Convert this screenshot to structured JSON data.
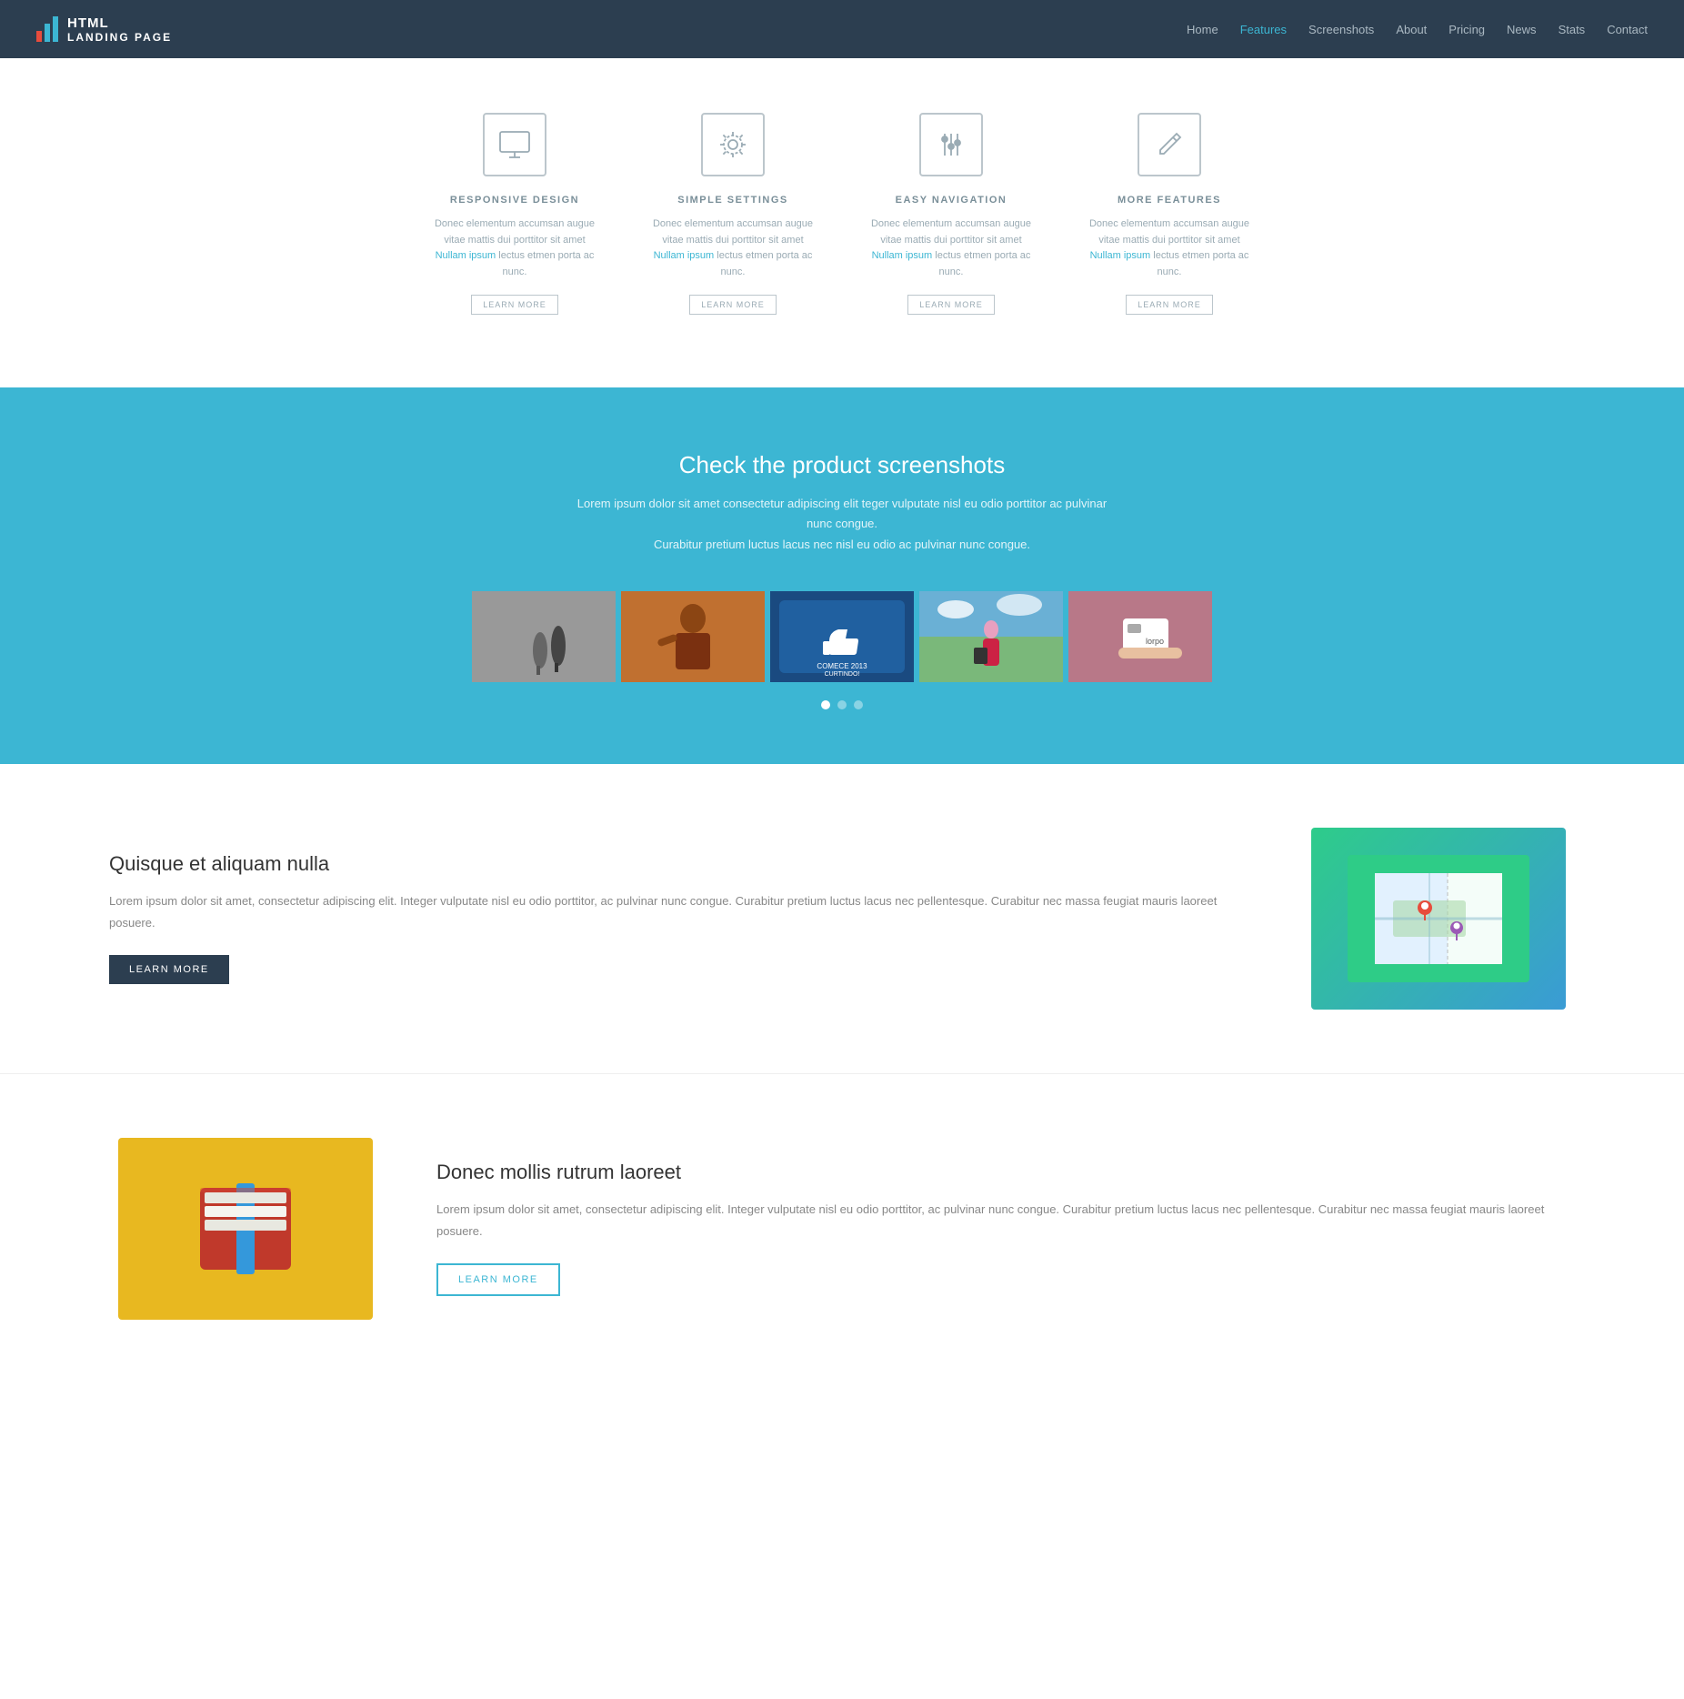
{
  "nav": {
    "brand_html": "HTML",
    "brand_sub": "LANDING PAGE",
    "links": [
      {
        "label": "Home",
        "active": false
      },
      {
        "label": "Features",
        "active": true
      },
      {
        "label": "Screenshots",
        "active": false
      },
      {
        "label": "About",
        "active": false
      },
      {
        "label": "Pricing",
        "active": false
      },
      {
        "label": "News",
        "active": false
      },
      {
        "label": "Stats",
        "active": false
      },
      {
        "label": "Contact",
        "active": false
      }
    ]
  },
  "features": {
    "items": [
      {
        "icon": "monitor",
        "title": "RESPONSIVE DESIGN",
        "text": "Donec elementum accumsan augue vitae mattis dui porttitor sit amet Nullam ipsum lectus etmen porta ac nunc.",
        "btn": "LEARN MORE"
      },
      {
        "icon": "gear",
        "title": "SIMPLE SETTINGS",
        "text": "Donec elementum accumsan augue vitae mattis dui porttitor sit amet Nullam ipsum lectus etmen porta ac nunc.",
        "btn": "LEARN MORE"
      },
      {
        "icon": "sliders",
        "title": "EASY NAVIGATION",
        "text": "Donec elementum accumsan augue vitae mattis dui porttitor sit amet Nullam ipsum lectus etmen porta ac nunc.",
        "btn": "LEARN MORE"
      },
      {
        "icon": "pencil",
        "title": "MORE FEATURES",
        "text": "Donec elementum accumsan augue vitae mattis dui porttitor sit amet Nullam ipsum lectus etmen porta ac nunc.",
        "btn": "LEARN MORE"
      }
    ]
  },
  "screenshots": {
    "title": "Check the product screenshots",
    "desc": "Lorem ipsum dolor sit amet consectetur adipiscing elit teger vulputate nisl eu odio porttitor ac pulvinar nunc congue.\nCurabitur pretium luctus lacus nec nisl eu odio ac pulvinar nunc congue.",
    "dots": 3
  },
  "section1": {
    "title": "Quisque et aliquam nulla",
    "desc": "Lorem ipsum dolor sit amet, consectetur adipiscing elit. Integer vulputate nisl eu odio porttitor, ac pulvinar nunc congue. Curabitur pretium luctus lacus nec pellentesque. Curabitur nec massa feugiat mauris laoreet posuere.",
    "btn": "LEARN MORE"
  },
  "section2": {
    "title": "Donec mollis rutrum laoreet",
    "desc": "Lorem ipsum dolor sit amet, consectetur adipiscing elit. Integer vulputate nisl eu odio porttitor, ac pulvinar nunc congue. Curabitur pretium luctus lacus nec pellentesque. Curabitur nec massa feugiat mauris laoreet posuere.",
    "btn": "LEARN MORE"
  }
}
